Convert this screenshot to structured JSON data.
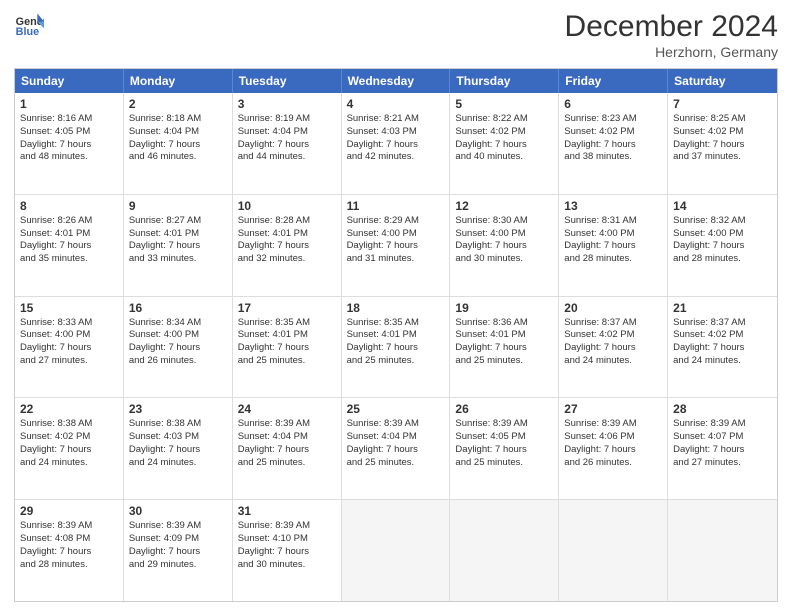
{
  "header": {
    "logo_line1": "General",
    "logo_line2": "Blue",
    "month": "December 2024",
    "location": "Herzhorn, Germany"
  },
  "weekdays": [
    "Sunday",
    "Monday",
    "Tuesday",
    "Wednesday",
    "Thursday",
    "Friday",
    "Saturday"
  ],
  "rows": [
    [
      {
        "day": "1",
        "lines": [
          "Sunrise: 8:16 AM",
          "Sunset: 4:05 PM",
          "Daylight: 7 hours",
          "and 48 minutes."
        ]
      },
      {
        "day": "2",
        "lines": [
          "Sunrise: 8:18 AM",
          "Sunset: 4:04 PM",
          "Daylight: 7 hours",
          "and 46 minutes."
        ]
      },
      {
        "day": "3",
        "lines": [
          "Sunrise: 8:19 AM",
          "Sunset: 4:04 PM",
          "Daylight: 7 hours",
          "and 44 minutes."
        ]
      },
      {
        "day": "4",
        "lines": [
          "Sunrise: 8:21 AM",
          "Sunset: 4:03 PM",
          "Daylight: 7 hours",
          "and 42 minutes."
        ]
      },
      {
        "day": "5",
        "lines": [
          "Sunrise: 8:22 AM",
          "Sunset: 4:02 PM",
          "Daylight: 7 hours",
          "and 40 minutes."
        ]
      },
      {
        "day": "6",
        "lines": [
          "Sunrise: 8:23 AM",
          "Sunset: 4:02 PM",
          "Daylight: 7 hours",
          "and 38 minutes."
        ]
      },
      {
        "day": "7",
        "lines": [
          "Sunrise: 8:25 AM",
          "Sunset: 4:02 PM",
          "Daylight: 7 hours",
          "and 37 minutes."
        ]
      }
    ],
    [
      {
        "day": "8",
        "lines": [
          "Sunrise: 8:26 AM",
          "Sunset: 4:01 PM",
          "Daylight: 7 hours",
          "and 35 minutes."
        ]
      },
      {
        "day": "9",
        "lines": [
          "Sunrise: 8:27 AM",
          "Sunset: 4:01 PM",
          "Daylight: 7 hours",
          "and 33 minutes."
        ]
      },
      {
        "day": "10",
        "lines": [
          "Sunrise: 8:28 AM",
          "Sunset: 4:01 PM",
          "Daylight: 7 hours",
          "and 32 minutes."
        ]
      },
      {
        "day": "11",
        "lines": [
          "Sunrise: 8:29 AM",
          "Sunset: 4:00 PM",
          "Daylight: 7 hours",
          "and 31 minutes."
        ]
      },
      {
        "day": "12",
        "lines": [
          "Sunrise: 8:30 AM",
          "Sunset: 4:00 PM",
          "Daylight: 7 hours",
          "and 30 minutes."
        ]
      },
      {
        "day": "13",
        "lines": [
          "Sunrise: 8:31 AM",
          "Sunset: 4:00 PM",
          "Daylight: 7 hours",
          "and 28 minutes."
        ]
      },
      {
        "day": "14",
        "lines": [
          "Sunrise: 8:32 AM",
          "Sunset: 4:00 PM",
          "Daylight: 7 hours",
          "and 28 minutes."
        ]
      }
    ],
    [
      {
        "day": "15",
        "lines": [
          "Sunrise: 8:33 AM",
          "Sunset: 4:00 PM",
          "Daylight: 7 hours",
          "and 27 minutes."
        ]
      },
      {
        "day": "16",
        "lines": [
          "Sunrise: 8:34 AM",
          "Sunset: 4:00 PM",
          "Daylight: 7 hours",
          "and 26 minutes."
        ]
      },
      {
        "day": "17",
        "lines": [
          "Sunrise: 8:35 AM",
          "Sunset: 4:01 PM",
          "Daylight: 7 hours",
          "and 25 minutes."
        ]
      },
      {
        "day": "18",
        "lines": [
          "Sunrise: 8:35 AM",
          "Sunset: 4:01 PM",
          "Daylight: 7 hours",
          "and 25 minutes."
        ]
      },
      {
        "day": "19",
        "lines": [
          "Sunrise: 8:36 AM",
          "Sunset: 4:01 PM",
          "Daylight: 7 hours",
          "and 25 minutes."
        ]
      },
      {
        "day": "20",
        "lines": [
          "Sunrise: 8:37 AM",
          "Sunset: 4:02 PM",
          "Daylight: 7 hours",
          "and 24 minutes."
        ]
      },
      {
        "day": "21",
        "lines": [
          "Sunrise: 8:37 AM",
          "Sunset: 4:02 PM",
          "Daylight: 7 hours",
          "and 24 minutes."
        ]
      }
    ],
    [
      {
        "day": "22",
        "lines": [
          "Sunrise: 8:38 AM",
          "Sunset: 4:02 PM",
          "Daylight: 7 hours",
          "and 24 minutes."
        ]
      },
      {
        "day": "23",
        "lines": [
          "Sunrise: 8:38 AM",
          "Sunset: 4:03 PM",
          "Daylight: 7 hours",
          "and 24 minutes."
        ]
      },
      {
        "day": "24",
        "lines": [
          "Sunrise: 8:39 AM",
          "Sunset: 4:04 PM",
          "Daylight: 7 hours",
          "and 25 minutes."
        ]
      },
      {
        "day": "25",
        "lines": [
          "Sunrise: 8:39 AM",
          "Sunset: 4:04 PM",
          "Daylight: 7 hours",
          "and 25 minutes."
        ]
      },
      {
        "day": "26",
        "lines": [
          "Sunrise: 8:39 AM",
          "Sunset: 4:05 PM",
          "Daylight: 7 hours",
          "and 25 minutes."
        ]
      },
      {
        "day": "27",
        "lines": [
          "Sunrise: 8:39 AM",
          "Sunset: 4:06 PM",
          "Daylight: 7 hours",
          "and 26 minutes."
        ]
      },
      {
        "day": "28",
        "lines": [
          "Sunrise: 8:39 AM",
          "Sunset: 4:07 PM",
          "Daylight: 7 hours",
          "and 27 minutes."
        ]
      }
    ],
    [
      {
        "day": "29",
        "lines": [
          "Sunrise: 8:39 AM",
          "Sunset: 4:08 PM",
          "Daylight: 7 hours",
          "and 28 minutes."
        ]
      },
      {
        "day": "30",
        "lines": [
          "Sunrise: 8:39 AM",
          "Sunset: 4:09 PM",
          "Daylight: 7 hours",
          "and 29 minutes."
        ]
      },
      {
        "day": "31",
        "lines": [
          "Sunrise: 8:39 AM",
          "Sunset: 4:10 PM",
          "Daylight: 7 hours",
          "and 30 minutes."
        ]
      },
      null,
      null,
      null,
      null
    ]
  ]
}
